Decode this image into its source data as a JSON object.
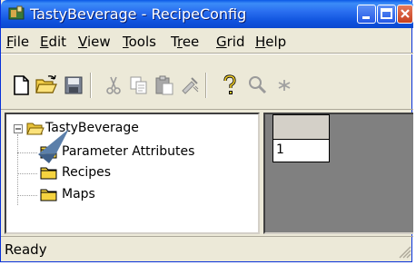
{
  "window": {
    "title": "TastyBeverage - RecipeConfig"
  },
  "menu": [
    {
      "label": "File",
      "underline": "F",
      "rest": "ile"
    },
    {
      "label": "Edit",
      "underline": "E",
      "rest": "dit"
    },
    {
      "label": "View",
      "underline": "V",
      "rest": "iew"
    },
    {
      "label": "Tools",
      "underline": "T",
      "rest": "ools"
    },
    {
      "label": "Tree",
      "pre": "T",
      "underline": "r",
      "rest": "ee"
    },
    {
      "label": "Grid",
      "underline": "G",
      "rest": "rid"
    },
    {
      "label": "Help",
      "underline": "H",
      "rest": "elp"
    }
  ],
  "toolbar": {
    "icons": [
      "new-icon",
      "open-icon",
      "save-icon",
      "cut-icon",
      "copy-icon",
      "paste-icon",
      "format-painter-icon",
      "help-icon",
      "find-icon",
      "star-icon"
    ]
  },
  "tree": {
    "root": "TastyBeverage",
    "children": [
      "Parameter Attributes",
      "Recipes",
      "Maps"
    ]
  },
  "grid": {
    "row_header": "1"
  },
  "status": {
    "text": "Ready"
  },
  "colors": {
    "titlebar": "#0a58e6",
    "face": "#ece9d8",
    "folder": "#f5d33f",
    "grid_bg": "#808080"
  }
}
